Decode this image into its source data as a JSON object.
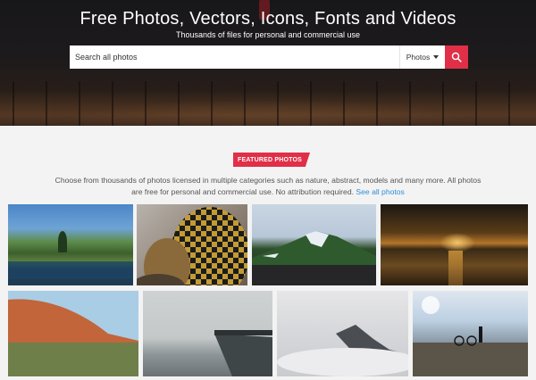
{
  "hero": {
    "title": "Free Photos, Vectors, Icons, Fonts and Videos",
    "subtitle": "Thousands of files for personal and commercial use"
  },
  "search": {
    "placeholder": "Search all photos",
    "category": "Photos",
    "icon": "search-icon"
  },
  "featured": {
    "badge": "FEATURED PHOTOS",
    "description": "Choose from thousands of photos licensed in multiple categories such as nature, abstract, models and many more. All photos are free for personal and commercial use. No attribution required.",
    "link": "See all photos"
  },
  "colors": {
    "accent": "#e02f47",
    "link": "#2d8fd8",
    "text": "#555555"
  }
}
